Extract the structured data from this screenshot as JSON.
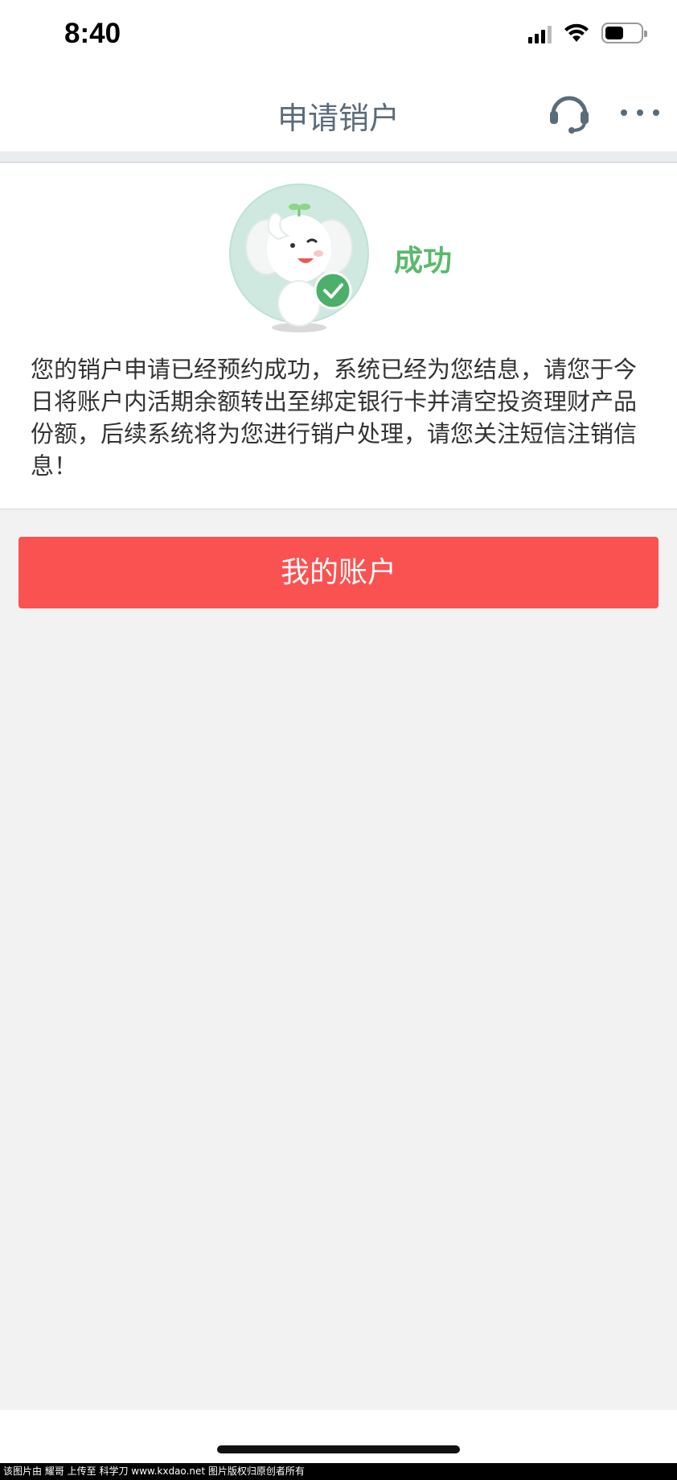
{
  "status_bar": {
    "time": "8:40"
  },
  "nav": {
    "title": "申请销户",
    "support_icon": "headset-icon",
    "more_icon": "more-dots-icon"
  },
  "result": {
    "status": "成功",
    "message": "您的销户申请已经预约成功，系统已经为您结息，请您于今日将账户内活期余额转出至绑定银行卡并清空投资理财产品份额，后续系统将为您进行销户处理，请您关注短信注销信息！",
    "mascot_icon": "elephant-mascot-success-icon"
  },
  "actions": {
    "my_account_label": "我的账户"
  },
  "footer": {
    "watermark": "该图片由 耀哥 上传至 科学刀 www.kxdao.net 图片版权归原创者所有"
  },
  "colors": {
    "accent_red": "#fa5151",
    "success_green": "#5bb96b",
    "nav_text": "#5b6b79",
    "background": "#f2f2f2"
  }
}
